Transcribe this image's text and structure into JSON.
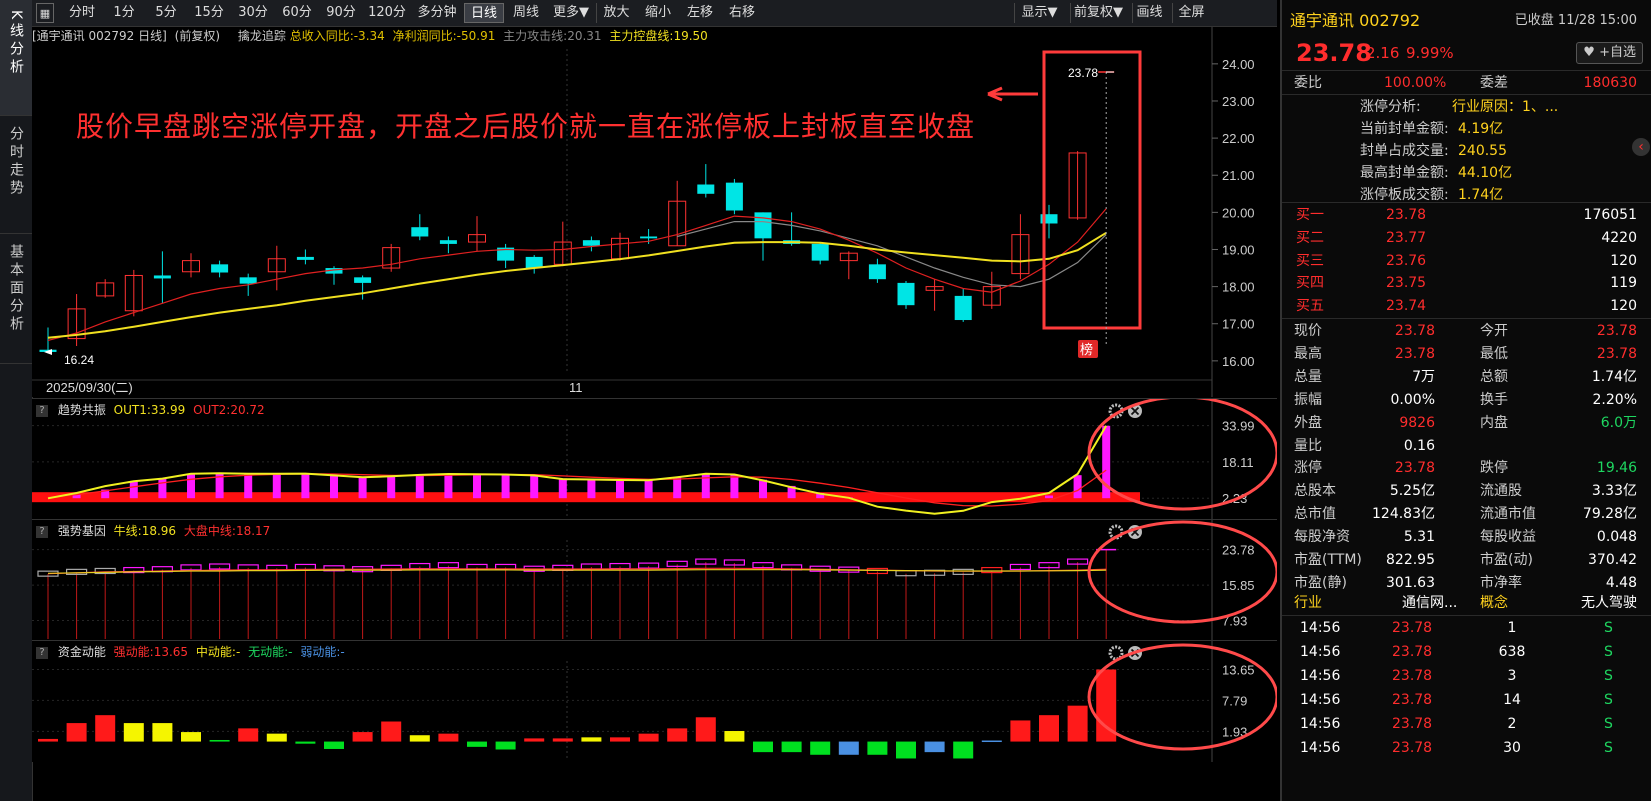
{
  "left_nav": [
    "K线分析",
    "分时走势",
    "基本面分析"
  ],
  "toolbar": {
    "items": [
      "分时",
      "1分",
      "5分",
      "15分",
      "30分",
      "60分",
      "90分",
      "120分",
      "多分钟",
      "日线",
      "周线",
      "更多▼",
      "放大",
      "缩小",
      "左移",
      "右移"
    ],
    "selected": "日线",
    "right_items": [
      "显示▼",
      "前复权▼",
      "画线",
      "全屏"
    ]
  },
  "main_chart": {
    "header": {
      "title": "[通宇通讯 002792 日线]",
      "adj": "(前复权)",
      "ind_name": "擒龙追踪",
      "v1": "总收入同比:-3.34",
      "v2": "净利润同比:-50.91",
      "v3": "主力攻击线:20.31",
      "v4": "主力控盘线:19.50"
    },
    "annotation": "股价早盘跳空涨停开盘，开盘之后股价就一直在涨停板上封板直至收盘",
    "price_axis": [
      "24.00",
      "23.00",
      "22.00",
      "21.00",
      "20.00",
      "19.00",
      "18.00",
      "17.00",
      "16.00"
    ],
    "min_label": "16.24",
    "max_label": "23.78",
    "date_left": "2025/09/30(二)",
    "date_mid": "11",
    "badge": "榜",
    "colors": {
      "up": "#ff3232",
      "down": "#00e5e5",
      "ma_red": "#e02020",
      "ma_yellow": "#f0e020",
      "ma_grey": "#888888",
      "annot": "#ff4040"
    },
    "ylim": [
      15.7,
      24.4
    ],
    "candles": [
      {
        "o": 16.3,
        "c": 16.24,
        "h": 16.9,
        "l": 16.2
      },
      {
        "o": 16.6,
        "c": 17.4,
        "h": 17.8,
        "l": 16.4
      },
      {
        "o": 17.75,
        "c": 18.1,
        "h": 18.2,
        "l": 17.7
      },
      {
        "o": 17.35,
        "c": 18.3,
        "h": 18.45,
        "l": 17.2
      },
      {
        "o": 18.3,
        "c": 18.22,
        "h": 18.95,
        "l": 17.55
      },
      {
        "o": 18.4,
        "c": 18.7,
        "h": 18.9,
        "l": 18.25
      },
      {
        "o": 18.6,
        "c": 18.38,
        "h": 18.7,
        "l": 18.25
      },
      {
        "o": 18.25,
        "c": 18.08,
        "h": 18.35,
        "l": 17.75
      },
      {
        "o": 18.4,
        "c": 18.75,
        "h": 19.1,
        "l": 17.9
      },
      {
        "o": 18.8,
        "c": 18.72,
        "h": 19.0,
        "l": 18.6
      },
      {
        "o": 18.5,
        "c": 18.35,
        "h": 18.55,
        "l": 18.05
      },
      {
        "o": 18.25,
        "c": 18.1,
        "h": 18.3,
        "l": 17.65
      },
      {
        "o": 18.5,
        "c": 19.05,
        "h": 19.15,
        "l": 18.4
      },
      {
        "o": 19.6,
        "c": 19.35,
        "h": 19.95,
        "l": 19.25
      },
      {
        "o": 19.25,
        "c": 19.15,
        "h": 19.35,
        "l": 18.9
      },
      {
        "o": 19.2,
        "c": 19.4,
        "h": 19.9,
        "l": 18.95
      },
      {
        "o": 19.05,
        "c": 18.7,
        "h": 19.15,
        "l": 18.5
      },
      {
        "o": 18.8,
        "c": 18.5,
        "h": 18.85,
        "l": 18.35
      },
      {
        "o": 18.6,
        "c": 19.2,
        "h": 19.75,
        "l": 18.55
      },
      {
        "o": 19.25,
        "c": 19.1,
        "h": 19.35,
        "l": 18.95
      },
      {
        "o": 18.75,
        "c": 19.3,
        "h": 19.45,
        "l": 18.7
      },
      {
        "o": 19.35,
        "c": 19.3,
        "h": 19.55,
        "l": 19.15
      },
      {
        "o": 19.1,
        "c": 20.3,
        "h": 20.85,
        "l": 19.1
      },
      {
        "o": 20.75,
        "c": 20.5,
        "h": 21.3,
        "l": 20.4
      },
      {
        "o": 20.8,
        "c": 20.05,
        "h": 20.9,
        "l": 19.95
      },
      {
        "o": 20.0,
        "c": 19.3,
        "h": 20.0,
        "l": 18.7
      },
      {
        "o": 19.25,
        "c": 19.15,
        "h": 20.0,
        "l": 19.1
      },
      {
        "o": 19.15,
        "c": 18.7,
        "h": 19.2,
        "l": 18.6
      },
      {
        "o": 18.7,
        "c": 18.9,
        "h": 18.95,
        "l": 18.2
      },
      {
        "o": 18.6,
        "c": 18.2,
        "h": 18.75,
        "l": 18.1
      },
      {
        "o": 18.1,
        "c": 17.5,
        "h": 18.15,
        "l": 17.4
      },
      {
        "o": 17.9,
        "c": 18.0,
        "h": 18.2,
        "l": 17.35
      },
      {
        "o": 17.75,
        "c": 17.1,
        "h": 17.95,
        "l": 17.05
      },
      {
        "o": 17.5,
        "c": 18.0,
        "h": 18.4,
        "l": 17.4
      },
      {
        "o": 18.35,
        "c": 19.4,
        "h": 19.95,
        "l": 18.2
      },
      {
        "o": 19.95,
        "c": 19.7,
        "h": 20.2,
        "l": 19.3
      },
      {
        "o": 19.85,
        "c": 21.6,
        "h": 21.65,
        "l": 19.8
      },
      {
        "o": 23.78,
        "c": 23.78,
        "h": 23.78,
        "l": 23.78
      }
    ],
    "ma_red": [
      16.55,
      16.75,
      17.05,
      17.3,
      17.55,
      17.8,
      17.95,
      18.05,
      18.2,
      18.35,
      18.45,
      18.5,
      18.6,
      18.75,
      18.85,
      18.95,
      19.0,
      18.98,
      19.0,
      19.08,
      19.15,
      19.22,
      19.4,
      19.65,
      19.9,
      19.85,
      19.75,
      19.55,
      19.25,
      18.9,
      18.5,
      18.2,
      17.95,
      17.85,
      18.15,
      18.6,
      19.2,
      20.1
    ],
    "ma_grey": [
      null,
      null,
      null,
      null,
      null,
      null,
      null,
      null,
      null,
      null,
      null,
      null,
      null,
      null,
      null,
      null,
      null,
      null,
      null,
      null,
      null,
      null,
      19.35,
      19.55,
      19.75,
      19.75,
      19.65,
      19.5,
      19.3,
      19.1,
      18.8,
      18.5,
      18.25,
      18.05,
      18.0,
      18.2,
      18.65,
      19.4
    ],
    "ma_yellow": [
      16.62,
      16.7,
      16.8,
      16.92,
      17.05,
      17.18,
      17.3,
      17.4,
      17.5,
      17.62,
      17.72,
      17.82,
      17.95,
      18.08,
      18.2,
      18.32,
      18.42,
      18.5,
      18.58,
      18.66,
      18.74,
      18.84,
      18.96,
      19.08,
      19.18,
      19.2,
      19.2,
      19.18,
      19.1,
      19.0,
      18.92,
      18.85,
      18.78,
      18.7,
      18.68,
      18.75,
      18.98,
      19.45
    ]
  },
  "trend_panel": {
    "name": "趋势共振",
    "out1": "OUT1:33.99",
    "out2": "OUT2:20.72",
    "axis": [
      "33.99",
      "18.11",
      "2.23"
    ],
    "ylim": [
      -6,
      36
    ],
    "bars": [
      2.2,
      4.2,
      6.0,
      9.6,
      10.6,
      12.8,
      13.0,
      12.9,
      12.9,
      13.0,
      12.4,
      11.6,
      11.8,
      12.3,
      12.7,
      12.7,
      12.6,
      12.3,
      10.9,
      10.7,
      10.3,
      10.2,
      11.4,
      12.7,
      12.6,
      10.3,
      7.6,
      4.5,
      2.6,
      -1.2,
      -2.8,
      -4.5,
      -3.0,
      0.4,
      1.5,
      3.4,
      12.3,
      33.9
    ],
    "yellow": [
      2.2,
      4.5,
      7.5,
      9.6,
      10.8,
      12.9,
      13.1,
      12.9,
      12.9,
      13.0,
      12.2,
      11.4,
      11.8,
      12.4,
      12.8,
      12.7,
      12.6,
      12.2,
      10.6,
      10.4,
      10.2,
      10.1,
      11.4,
      12.9,
      12.6,
      10.0,
      7.0,
      4.2,
      2.4,
      -1.5,
      -3.2,
      -4.6,
      -3.3,
      0.5,
      2.0,
      4.5,
      12.8,
      33.9
    ],
    "red": [
      2.6,
      3.8,
      5.4,
      7.2,
      8.9,
      10.5,
      11.6,
      12.3,
      12.7,
      12.9,
      12.8,
      12.5,
      12.2,
      12.1,
      12.3,
      12.5,
      12.6,
      12.5,
      12.0,
      11.4,
      10.9,
      10.5,
      10.6,
      11.1,
      11.6,
      11.4,
      10.4,
      8.8,
      6.9,
      4.6,
      2.3,
      0.2,
      -1.0,
      -1.2,
      -0.4,
      1.2,
      5.6,
      14.5
    ],
    "band": 2.23
  },
  "strong_panel": {
    "name": "强势基因",
    "v1": "牛线:18.96",
    "v2": "大盘中线:18.17",
    "axis": [
      "23.78",
      "15.85",
      "7.93"
    ],
    "ylim": [
      4,
      25.5
    ],
    "vals": [
      18.3,
      18.7,
      18.9,
      19.1,
      19.3,
      19.7,
      19.9,
      19.7,
      19.6,
      19.8,
      19.5,
      19.3,
      19.6,
      20.0,
      20.2,
      19.8,
      19.8,
      19.4,
      19.6,
      19.9,
      20.0,
      20.1,
      20.5,
      21.0,
      20.8,
      20.2,
      19.7,
      19.4,
      19.2,
      18.9,
      18.4,
      18.5,
      18.7,
      19.1,
      19.8,
      20.2,
      21.0,
      23.78
    ],
    "kinds": [
      "g",
      "g",
      "g",
      "m",
      "m",
      "m",
      "m",
      "m",
      "m",
      "m",
      "m",
      "m",
      "m",
      "m",
      "m",
      "m",
      "m",
      "m",
      "m",
      "m",
      "m",
      "m",
      "m",
      "m",
      "m",
      "m",
      "m",
      "m",
      "m",
      "r",
      "g",
      "g",
      "g",
      "r",
      "m",
      "m",
      "m",
      "m"
    ],
    "line_red": [
      18.4,
      18.6,
      18.8,
      18.9,
      19.0,
      19.1,
      19.2,
      19.25,
      19.3,
      19.35,
      19.4,
      19.4,
      19.45,
      19.5,
      19.5,
      19.5,
      19.5,
      19.45,
      19.45,
      19.45,
      19.5,
      19.5,
      19.55,
      19.6,
      19.6,
      19.55,
      19.5,
      19.4,
      19.3,
      19.2,
      19.1,
      19.0,
      18.95,
      18.95,
      19.0,
      19.1,
      19.2,
      19.4
    ],
    "line_yellow": [
      18.5,
      18.6,
      18.7,
      18.8,
      18.9,
      19.0,
      19.0,
      19.1,
      19.1,
      19.15,
      19.2,
      19.2,
      19.2,
      19.25,
      19.25,
      19.25,
      19.25,
      19.2,
      19.2,
      19.2,
      19.2,
      19.2,
      19.25,
      19.3,
      19.3,
      19.3,
      19.3,
      19.25,
      19.2,
      19.15,
      19.1,
      19.05,
      19.0,
      19.0,
      19.0,
      19.05,
      19.1,
      19.2
    ]
  },
  "money_panel": {
    "name": "资金动能",
    "v1": "强动能:13.65",
    "v2": "中动能:-",
    "v3": "无动能:-",
    "v4": "弱动能:-",
    "axis": [
      "13.65",
      "7.79",
      "1.93"
    ],
    "ylim": [
      -3.3,
      14.5
    ],
    "vals": [
      0.5,
      3.5,
      5.0,
      3.5,
      3.5,
      1.8,
      0.3,
      2.5,
      1.5,
      -0.4,
      -1.4,
      1.8,
      3.8,
      1.2,
      1.5,
      -1.0,
      -1.5,
      0.6,
      0.6,
      0.8,
      0.8,
      1.5,
      2.5,
      4.6,
      2.0,
      -2.0,
      -2.0,
      -2.5,
      -2.5,
      -2.5,
      -3.2,
      -2.0,
      -3.2,
      0.2,
      4.0,
      5.0,
      6.8,
      13.65
    ],
    "kinds": [
      "r",
      "r",
      "r",
      "y",
      "y",
      "y",
      "g",
      "r",
      "y",
      "g",
      "g",
      "r",
      "r",
      "y",
      "r",
      "g",
      "g",
      "r",
      "r",
      "y",
      "r",
      "r",
      "r",
      "r",
      "y",
      "g",
      "g",
      "g",
      "b",
      "g",
      "g",
      "b",
      "g",
      "b",
      "r",
      "r",
      "r",
      "r"
    ],
    "colors": {
      "r": "#ff1a1a",
      "y": "#f5f500",
      "g": "#00e020",
      "b": "#4a90e2"
    }
  },
  "right": {
    "name_code": "通宇通讯 002792",
    "status": "已收盘 11/28 15:00",
    "price": "23.78",
    "change": "2.16",
    "pct": "9.99%",
    "fav": "+自选",
    "weibi_l": "委比",
    "weibi_v": "100.00%",
    "weicha_l": "委差",
    "weicha_v": "180630",
    "zt_label": "涨停分析:",
    "zt_reason": "行业原因：1、...",
    "zt_rows": [
      {
        "l": "当前封单金额:",
        "v": "4.19亿"
      },
      {
        "l": "封单占成交量:",
        "v": "240.55"
      },
      {
        "l": "最高封单金额:",
        "v": "44.10亿"
      },
      {
        "l": "涨停板成交额:",
        "v": "1.74亿"
      }
    ],
    "buys": [
      {
        "l": "买一",
        "p": "23.78",
        "v": "176051"
      },
      {
        "l": "买二",
        "p": "23.77",
        "v": "4220"
      },
      {
        "l": "买三",
        "p": "23.76",
        "v": "120"
      },
      {
        "l": "买四",
        "p": "23.75",
        "v": "119"
      },
      {
        "l": "买五",
        "p": "23.74",
        "v": "120"
      }
    ],
    "stats": [
      {
        "l1": "现价",
        "v1": "23.78",
        "c1": "red",
        "l2": "今开",
        "v2": "23.78",
        "c2": "red"
      },
      {
        "l1": "最高",
        "v1": "23.78",
        "c1": "red",
        "l2": "最低",
        "v2": "23.78",
        "c2": "red"
      },
      {
        "l1": "总量",
        "v1": "7万",
        "c1": "white",
        "l2": "总额",
        "v2": "1.74亿",
        "c2": "white"
      },
      {
        "l1": "振幅",
        "v1": "0.00%",
        "c1": "white",
        "l2": "换手",
        "v2": "2.20%",
        "c2": "white"
      },
      {
        "l1": "外盘",
        "v1": "9826",
        "c1": "red",
        "l2": "内盘",
        "v2": "6.0万",
        "c2": "green"
      },
      {
        "l1": "量比",
        "v1": "0.16",
        "c1": "white",
        "l2": "",
        "v2": "",
        "c2": "white"
      },
      {
        "l1": "涨停",
        "v1": "23.78",
        "c1": "red",
        "l2": "跌停",
        "v2": "19.46",
        "c2": "green"
      },
      {
        "l1": "总股本",
        "v1": "5.25亿",
        "c1": "white",
        "l2": "流通股",
        "v2": "3.33亿",
        "c2": "white"
      },
      {
        "l1": "总市值",
        "v1": "124.83亿",
        "c1": "white",
        "l2": "流通市值",
        "v2": "79.28亿",
        "c2": "white"
      },
      {
        "l1": "每股净资",
        "v1": "5.31",
        "c1": "white",
        "l2": "每股收益",
        "v2": "0.048",
        "c2": "white"
      },
      {
        "l1": "市盈(TTM)",
        "v1": "822.95",
        "c1": "white",
        "l2": "市盈(动)",
        "v2": "370.42",
        "c2": "white"
      },
      {
        "l1": "市盈(静)",
        "v1": "301.63",
        "c1": "white",
        "l2": "市净率",
        "v2": "4.48",
        "c2": "white"
      }
    ],
    "industry_l": "行业",
    "industry_v": "通信网...",
    "concept_l": "概念",
    "concept_v": "无人驾驶",
    "ticks": [
      {
        "t": "14:56",
        "p": "23.78",
        "v": "1",
        "s": "S"
      },
      {
        "t": "14:56",
        "p": "23.78",
        "v": "638",
        "s": "S"
      },
      {
        "t": "14:56",
        "p": "23.78",
        "v": "3",
        "s": "S"
      },
      {
        "t": "14:56",
        "p": "23.78",
        "v": "14",
        "s": "S"
      },
      {
        "t": "14:56",
        "p": "23.78",
        "v": "2",
        "s": "S"
      },
      {
        "t": "14:56",
        "p": "23.78",
        "v": "30",
        "s": "S"
      }
    ]
  }
}
